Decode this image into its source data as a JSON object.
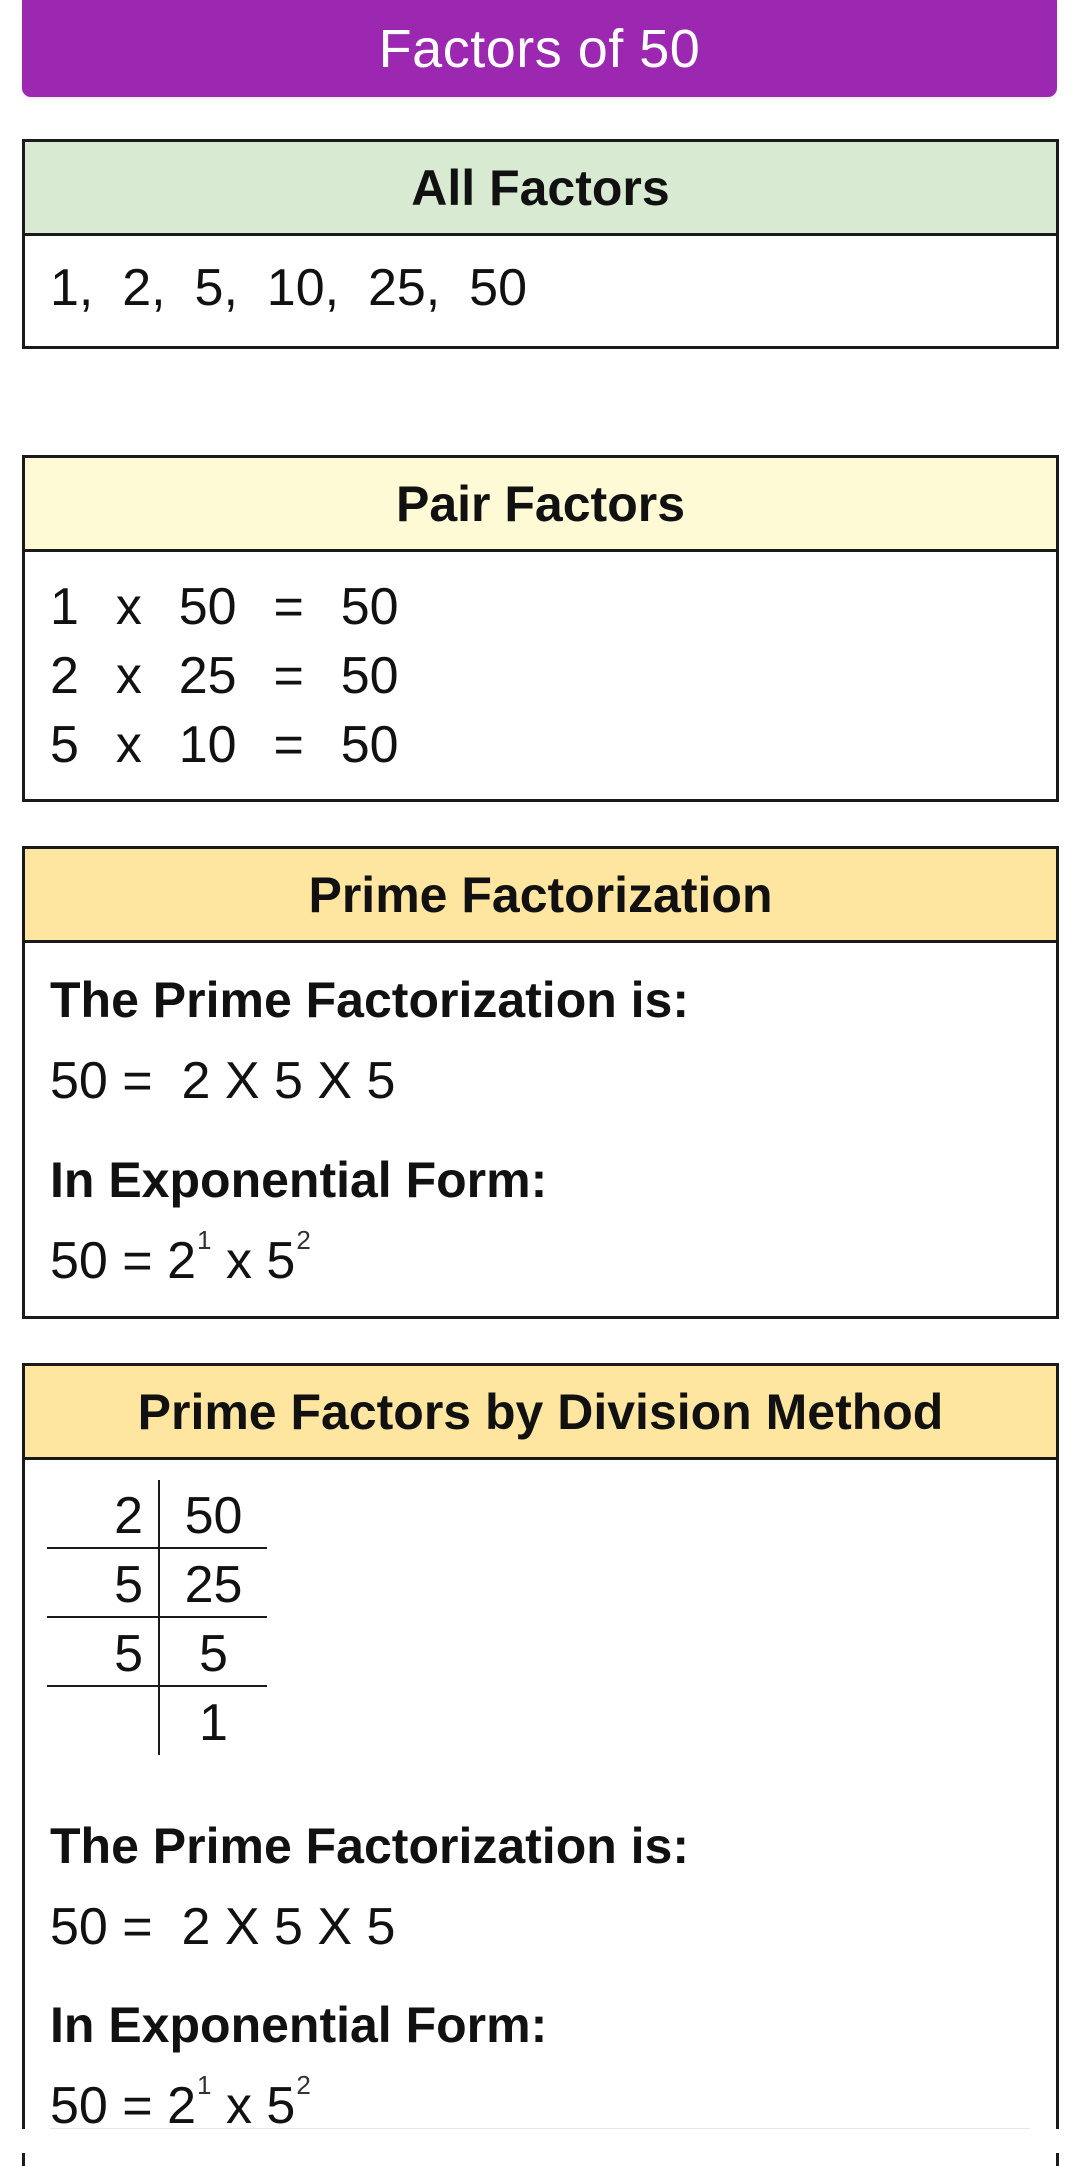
{
  "title": "Factors of 50",
  "colors": {
    "title_bar": "#9c27b0",
    "all_factors_header": "#d9ead3",
    "pair_factors_header": "#fffad6",
    "prime_header": "#ffe6a0"
  },
  "all_factors": {
    "heading": "All Factors",
    "values": "1,  2,  5,  10,  25,  50"
  },
  "pair_factors": {
    "heading": "Pair Factors",
    "rows": [
      "1  x  50  =  50",
      "2  x  25  =  50",
      "5  x  10  =  50"
    ]
  },
  "prime_factorization": {
    "heading": "Prime Factorization",
    "label": "The Prime Factorization is:",
    "equation": "50 =  2 X 5 X 5",
    "exp_label": "In Exponential Form:",
    "exp_lhs": "50 = 2",
    "exp_pow1": "1",
    "exp_mid": " x 5",
    "exp_pow2": "2"
  },
  "division_method": {
    "heading": "Prime Factors by Division Method",
    "rows": [
      {
        "divisor": "2",
        "dividend": "50"
      },
      {
        "divisor": "5",
        "dividend": "25"
      },
      {
        "divisor": "5",
        "dividend": "5"
      },
      {
        "divisor": "",
        "dividend": "1"
      }
    ],
    "label": "The Prime Factorization is:",
    "equation": "50 =  2 X 5 X 5",
    "exp_label": "In Exponential Form:",
    "exp_lhs": "50 = 2",
    "exp_pow1": "1",
    "exp_mid": " x 5",
    "exp_pow2": "2"
  }
}
